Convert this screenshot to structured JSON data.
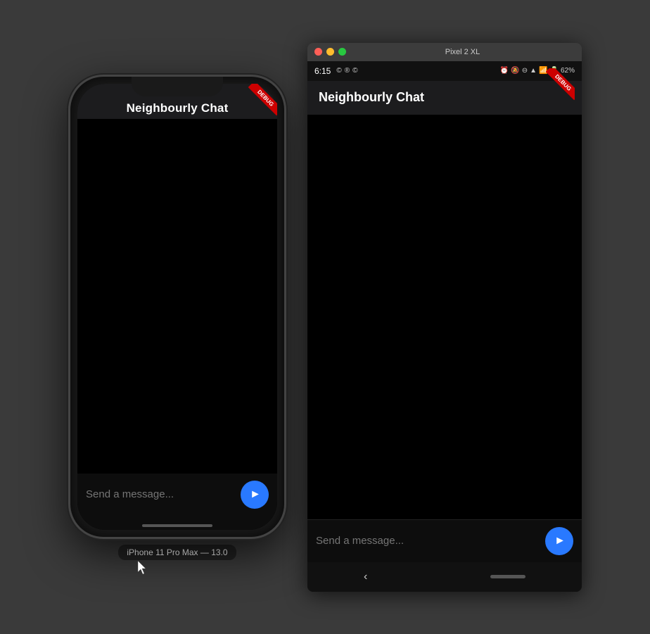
{
  "background_color": "#3a3a3a",
  "iphone": {
    "model_label": "iPhone 11 Pro Max — 13.0",
    "app_title": "Neighbourly Chat",
    "input_placeholder": "Send a message...",
    "send_button_label": "Send",
    "debug_label": "DEBUG",
    "home_bar_visible": true
  },
  "pixel": {
    "window_title": "Pixel 2 XL",
    "app_title": "Neighbourly Chat",
    "status_time": "6:15",
    "status_icons": "© ® ©",
    "status_right": "⏰ 🔕 ⊖ 📶 🔋 62%",
    "battery_percent": "62%",
    "input_placeholder": "Send a message...",
    "send_button_label": "Send",
    "debug_label": "DEBUG"
  },
  "colors": {
    "send_button": "#2979ff",
    "app_bar": "#1c1c1e",
    "debug_badge": "#cc0000",
    "chat_bg": "#000000",
    "input_bg": "#0d0d0d"
  }
}
